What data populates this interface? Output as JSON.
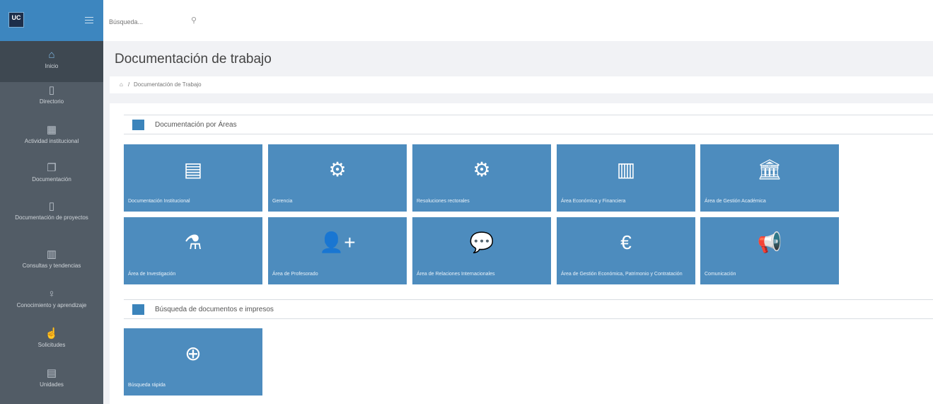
{
  "sidebar": {
    "logo_text": "UC",
    "items": [
      {
        "label": "Inicio",
        "icon": "home-icon",
        "glyph": "⌂"
      },
      {
        "label": "Directorio",
        "icon": "directory-icon",
        "glyph": "▯"
      },
      {
        "label": "Actividad institucional",
        "icon": "calendar-icon",
        "glyph": "▦"
      },
      {
        "label": "Documentación",
        "icon": "documents-icon",
        "glyph": "❐"
      },
      {
        "label": "Documentación de proyectos",
        "icon": "project-docs-icon",
        "glyph": "▯"
      },
      {
        "label": "Consultas y tendencias",
        "icon": "chart-icon",
        "glyph": "▥"
      },
      {
        "label": "Conocimiento y aprendizaje",
        "icon": "lightbulb-icon",
        "glyph": "♀"
      },
      {
        "label": "Solicitudes",
        "icon": "thumbs-up-icon",
        "glyph": "☝"
      },
      {
        "label": "Unidades",
        "icon": "units-icon",
        "glyph": "▤"
      }
    ]
  },
  "topbar": {
    "search_placeholder": "Búsqueda...",
    "search_icon_glyph": "⚲"
  },
  "page": {
    "title": "Documentación de trabajo",
    "breadcrumb_home_glyph": "⌂",
    "breadcrumb_sep": "/",
    "breadcrumb_current": "Documentación de Trabajo"
  },
  "sections": [
    {
      "title": "Documentación por Áreas"
    },
    {
      "title": "Búsqueda de documentos e impresos"
    }
  ],
  "tiles_areas": [
    {
      "label": "Documentación Institucional",
      "icon": "newspaper-icon",
      "glyph": "▤"
    },
    {
      "label": "Gerencia",
      "icon": "gears-icon",
      "glyph": "⚙"
    },
    {
      "label": "Resoluciones rectorales",
      "icon": "gears-icon",
      "glyph": "⚙"
    },
    {
      "label": "Área Económica y Financiera",
      "icon": "bar-chart-icon",
      "glyph": "▥"
    },
    {
      "label": "Área de Gestión Académica",
      "icon": "institution-icon",
      "glyph": "🏛"
    },
    {
      "label": "Área de Investigación",
      "icon": "flask-icon",
      "glyph": "⚗"
    },
    {
      "label": "Área de Profesorado",
      "icon": "add-user-icon",
      "glyph": "👤+"
    },
    {
      "label": "Área de Relaciones Internacionales",
      "icon": "comments-icon",
      "glyph": "💬"
    },
    {
      "label": "Área de Gestión Económica, Patrimonio y Contratación",
      "icon": "euro-icon",
      "glyph": "€"
    },
    {
      "label": "Comunicación",
      "icon": "megaphone-icon",
      "glyph": "📢"
    }
  ],
  "tiles_search": [
    {
      "label": "Búsqueda rápida",
      "icon": "zoom-in-icon",
      "glyph": "⊕"
    }
  ],
  "colors": {
    "accent": "#3d86bf",
    "tile": "#4d8cbe",
    "sidebar": "#525c66"
  }
}
